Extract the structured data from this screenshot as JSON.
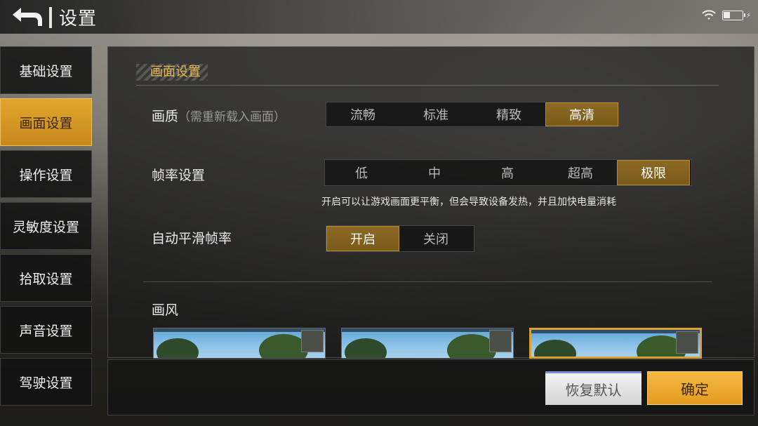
{
  "header": {
    "title": "设置",
    "back_icon": "back-arrow-icon",
    "wifi_icon": "wifi-icon",
    "battery_icon": "battery-charging-icon"
  },
  "sidebar": {
    "items": [
      {
        "label": "基础设置",
        "active": false
      },
      {
        "label": "画面设置",
        "active": true
      },
      {
        "label": "操作设置",
        "active": false
      },
      {
        "label": "灵敏度设置",
        "active": false
      },
      {
        "label": "拾取设置",
        "active": false
      },
      {
        "label": "声音设置",
        "active": false
      },
      {
        "label": "驾驶设置",
        "active": false
      }
    ]
  },
  "main": {
    "section_title": "画面设置",
    "quality": {
      "label": "画质",
      "note": "（需重新载入画面）",
      "options": [
        "流畅",
        "标准",
        "精致",
        "高清"
      ],
      "selected": "高清"
    },
    "framerate": {
      "label": "帧率设置",
      "options": [
        "低",
        "中",
        "高",
        "超高",
        "极限"
      ],
      "selected": "极限",
      "hint": "开启可以让游戏画面更平衡，但会导致设备发热，并且加快电量消耗"
    },
    "smooth_framerate": {
      "label": "自动平滑帧率",
      "options": [
        "开启",
        "关闭"
      ],
      "selected": "开启"
    },
    "style": {
      "label": "画风",
      "selected_index": 2
    }
  },
  "footer": {
    "reset_label": "恢复默认",
    "ok_label": "确定"
  },
  "colors": {
    "accent": "#e1a62e",
    "selected_option": "#7a5a1a",
    "section_title": "#e7b84d"
  }
}
